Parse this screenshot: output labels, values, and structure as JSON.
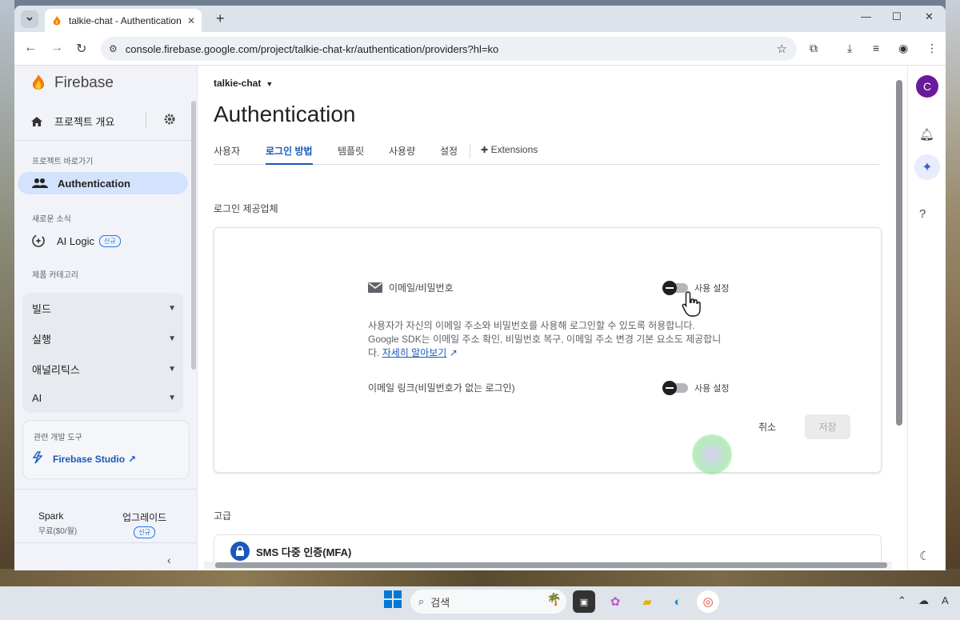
{
  "browser": {
    "tab_title": "talkie-chat - Authentication - F",
    "url": "console.firebase.google.com/project/talkie-chat-kr/authentication/providers?hl=ko",
    "tab_menu_icon": "chevron-down-icon",
    "new_tab_icon": "+"
  },
  "sidebar": {
    "brand": "Firebase",
    "overview": "프로젝트 개요",
    "shortcuts_label": "프로젝트 바로가기",
    "auth_item": "Authentication",
    "news_label": "새로운 소식",
    "ai_logic": "AI Logic",
    "new_badge": "신규",
    "categories_label": "제품 카테고리",
    "categories": [
      "빌드",
      "실행",
      "애널리틱스",
      "AI"
    ],
    "tools_label": "관련 개발 도구",
    "studio": "Firebase Studio",
    "plan_name": "Spark",
    "plan_price": "무료($0/월)",
    "upgrade": "업그레이드",
    "upgrade_badge": "신규"
  },
  "main": {
    "project": "talkie-chat",
    "title": "Authentication",
    "tabs": [
      "사용자",
      "로그인 방법",
      "템플릿",
      "사용량",
      "설정",
      "Extensions"
    ],
    "active_tab": "로그인 방법",
    "providers_label": "로그인 제공업체",
    "email_provider": "이메일/비밀번호",
    "toggle_label": "사용 설정",
    "desc_line1": "사용자가 자신의 이메일 주소와 비밀번호를 사용해 로그인할 수 있도록 허용합니다.",
    "desc_line2": "Google SDK는 이메일 주소 확인, 비밀번호 복구, 이메일 주소 변경 기본 요소도 제공합니",
    "desc_prefix": "다.",
    "learn_more": "자세히 알아보기",
    "email_link": "이메일 링크(비밀번호가 없는 로그인)",
    "cancel": "취소",
    "save": "저장",
    "advanced_label": "고급",
    "sms_mfa": "SMS 다중 인증(MFA)"
  },
  "rail": {
    "avatar_letter": "C"
  },
  "taskbar": {
    "search_placeholder": "검색",
    "ime": "A"
  },
  "colors": {
    "accent": "#1a59b8",
    "active_nav_bg": "#d3e3fd",
    "avatar": "#6a1b9a"
  }
}
